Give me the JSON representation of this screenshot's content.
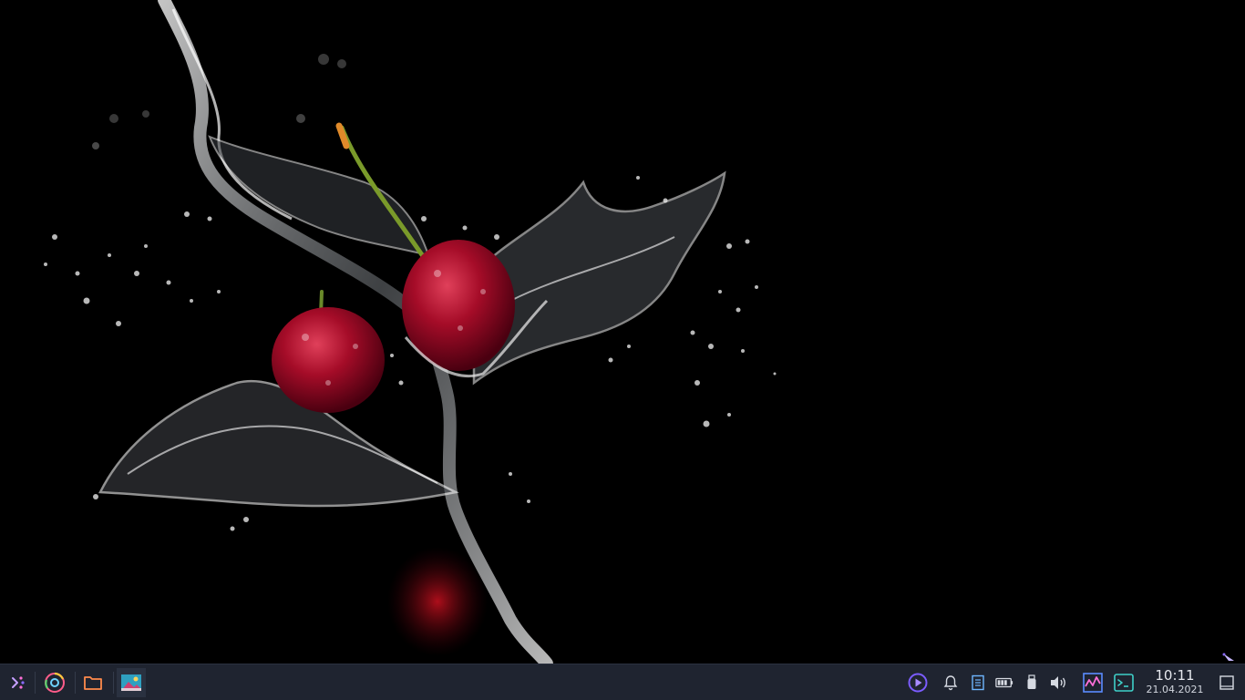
{
  "wallpaper": {
    "description_icon": "cherries-water-splash-wallpaper",
    "background_color": "#000000",
    "cherry_color": "#b0102a",
    "water_color": "#e8e8e8"
  },
  "taskbar": {
    "background_color": "#1f2430",
    "launcher": {
      "icon": "app-launcher-icon"
    },
    "pinned_apps": [
      {
        "name": "chrome",
        "icon": "chrome-icon"
      },
      {
        "name": "files",
        "icon": "folder-icon"
      },
      {
        "name": "image-viewer",
        "icon": "image-viewer-icon"
      }
    ],
    "tray": [
      {
        "name": "media-player",
        "icon": "media-play-icon"
      },
      {
        "name": "notifications",
        "icon": "bell-icon"
      },
      {
        "name": "clipboard",
        "icon": "clipboard-icon"
      },
      {
        "name": "battery",
        "icon": "battery-icon"
      },
      {
        "name": "usb",
        "icon": "usb-icon"
      },
      {
        "name": "volume",
        "icon": "speaker-icon"
      },
      {
        "name": "system-monitor",
        "icon": "system-monitor-icon"
      },
      {
        "name": "terminal",
        "icon": "terminal-icon"
      }
    ],
    "clock": {
      "time": "10:11",
      "date": "21.04.2021"
    },
    "show_desktop": {
      "icon": "show-desktop-icon"
    }
  }
}
